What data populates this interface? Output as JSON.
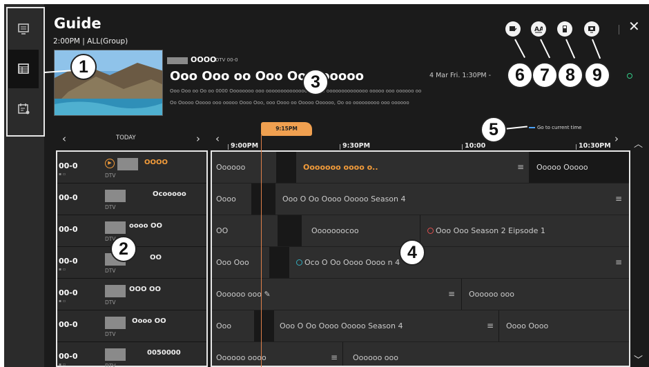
{
  "header": {
    "title": "Guide",
    "subtitle": "2:00PM | ALL(Group)",
    "close_label": "✕"
  },
  "sidebar": {
    "items": [
      {
        "icon": "tv-list-icon"
      },
      {
        "icon": "guide-grid-icon",
        "active": true
      },
      {
        "icon": "schedule-icon"
      }
    ]
  },
  "current": {
    "channel_name": "OOOO",
    "channel_num": "DTV 00-0",
    "program_title": "Ooo Ooo oo Ooo Oo      Oooooo",
    "date": "4 Mar Fri. 1:30PM -",
    "desc1": "Ooo Ooo oo Oo oo 0000 Oooooooo ooo oooooooooooooooooooo oooooooooooooo ooooo ooo oooooo oo",
    "desc2": "Oo Ooooo Ooooo ooo ooooo Oooo Ooo, ooo Oooo oo Ooooo Oooooo, Oo oo ooooooooo ooo oooooo"
  },
  "callouts": [
    "1",
    "2",
    "3",
    "4",
    "5",
    "6",
    "7",
    "8",
    "9"
  ],
  "timeline": {
    "today": "TODAY",
    "now_tag": "9:15PM",
    "times": [
      "9:00PM",
      "9:30PM",
      "10:00",
      "10:30PM"
    ],
    "go_current": "Go to current time"
  },
  "channels": [
    {
      "num": "00-0",
      "name": "OOOO",
      "playing": true
    },
    {
      "num": "00-0",
      "name": "Ocooooo",
      "playing": false
    },
    {
      "num": "00-0",
      "name": "oooo OO",
      "playing": false
    },
    {
      "num": "00-0",
      "name": "OO",
      "playing": false
    },
    {
      "num": "00-0",
      "name": "OOO OO",
      "playing": false
    },
    {
      "num": "00-0",
      "name": "Oooo OO",
      "playing": false
    },
    {
      "num": "00-0",
      "name": "0050000",
      "playing": false
    }
  ],
  "channel_type": "DTV",
  "programs": {
    "r0": [
      "Oooooo",
      "Ooooooo oooo o..",
      "Ooooo Ooooo"
    ],
    "r1": [
      "Oooo",
      "Ooo O Oo Oooo Ooooo Season 4"
    ],
    "r2": [
      "OO",
      "Ooooooocoo",
      "Ooo Ooo  Season 2 Eipsode 1"
    ],
    "r3": [
      "Ooo Ooo",
      "Oco O Oo Oooo Oooo   n 4"
    ],
    "r4": [
      "Oooooo ooo",
      "Oooooo ooo"
    ],
    "r5": [
      "Ooo",
      "Ooo O Oo Oooo Ooooo  Season 4",
      "Oooo Oooo"
    ],
    "r6": [
      "Oooooo oooo",
      "Oooooo ooo"
    ]
  },
  "colors": {
    "accent": "#f39c3a",
    "now_line": "#e0804a",
    "background": "#1b1b1b"
  }
}
